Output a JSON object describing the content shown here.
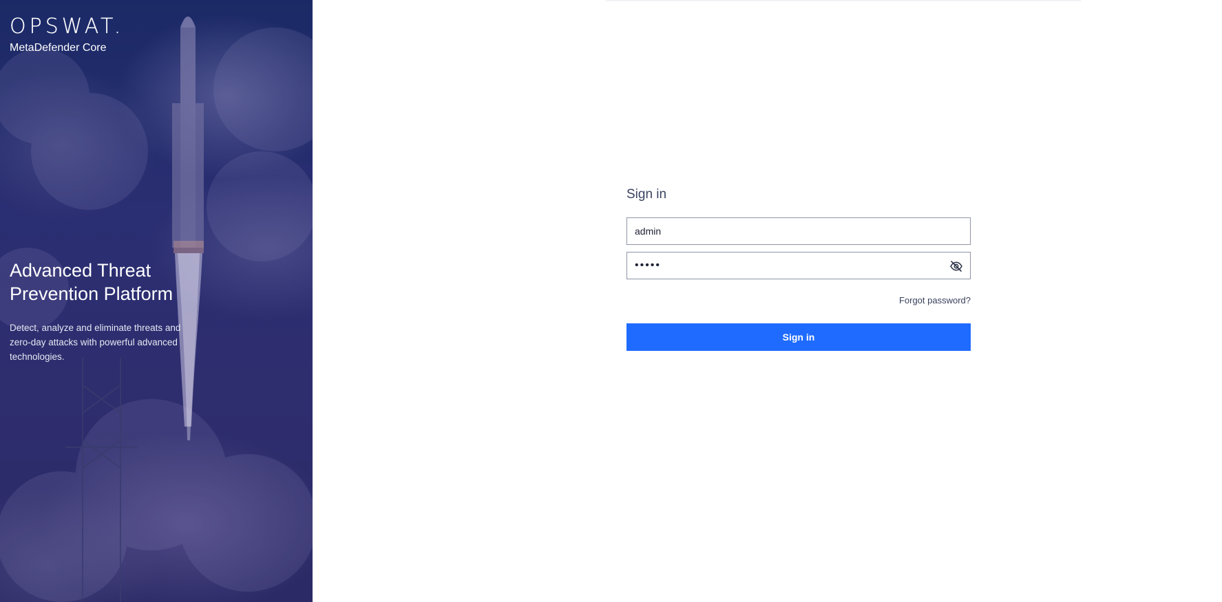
{
  "brand": {
    "logo_text": "OPSWAT.",
    "product_name": "MetaDefender Core"
  },
  "hero": {
    "title": "Advanced Threat Prevention Platform",
    "description": "Detect, analyze and eliminate threats and zero-day attacks with powerful advanced technologies."
  },
  "signin": {
    "title": "Sign in",
    "username_value": "admin",
    "password_value": "•••••",
    "forgot_password_label": "Forgot password?",
    "submit_label": "Sign in",
    "password_toggle_icon": "eye-off-icon"
  },
  "colors": {
    "accent": "#1F6BFF",
    "hero_background": "#2A2E72",
    "heading_text": "#394360"
  }
}
